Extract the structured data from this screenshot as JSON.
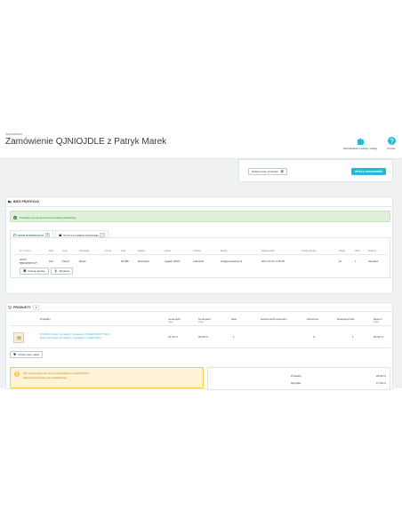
{
  "header": {
    "breadcrumb": "Zamówienia",
    "title": "Zamówienie QJNIOJDLE z Patryk Marek",
    "tools": [
      {
        "label": "Zarzadzanie modułyi i usługi",
        "icon": "puzzle-icon"
      },
      {
        "label": "Pomoc",
        "icon": "help-icon"
      }
    ]
  },
  "top_strip": {
    "tracking_label": "Podaj numer przesyłki",
    "submit_label": "WYŚLIJ WIADOMOŚĆ"
  },
  "returns": {
    "title": "BIEG PRZESYŁKI",
    "success_alert": "Przesyłka nie ma opóźnień od ostatniej aktualizacji",
    "tabs": [
      {
        "label": "STATUS PRZESYŁKI",
        "count": "0"
      },
      {
        "label": "WYSYŁKI (ZREALIZOWANE)",
        "count": "1"
      }
    ],
    "columns": [
      "Nr. Numer",
      "Płeć",
      "Imię",
      "Nazwisko",
      "Firma",
      "Kod",
      "Miasto",
      "Adres",
      "Telefon",
      "Email",
      "Data Krótko",
      "Uwagi dla kur.",
      "Waga",
      "Ilość",
      "Rodzaj"
    ],
    "row": [
      "32376",
      "Pan",
      "Patryk",
      "Marek",
      "",
      "00-585",
      "Dzierżków",
      "Jagiełły 06/15",
      "111111111",
      "info@prestashop.pl",
      "2017-07-01 17:59:56",
      "",
      "10",
      "1",
      "Standard"
    ],
    "row_sub": "5884483877377",
    "actions": [
      {
        "label": "Drukuj paczkę",
        "icon": "print-icon"
      },
      {
        "label": "Wydanie",
        "icon": "upload-icon"
      }
    ]
  },
  "products": {
    "title": "PRODUKTY",
    "count": "1",
    "columns": [
      {
        "label": "Produkty",
        "sub": ""
      },
      {
        "label": "Cena jedn.",
        "sub": "netto"
      },
      {
        "label": "Cena jedn.",
        "sub": "brutto"
      },
      {
        "label": "Ilość",
        "sub": ""
      },
      {
        "label": "Zwrócono/Z powrotem",
        "sub": ""
      },
      {
        "label": "Zwrócono",
        "sub": ""
      },
      {
        "label": "Dostępna ilość",
        "sub": ""
      },
      {
        "label": "Razem",
        "sub": "brutto"
      }
    ],
    "item": {
      "name_line1": "DYLMICO krem do twarzy z kwasami NAGIETKOWY 50ml",
      "name_line2": "Krem odżywczy do twarzy z wyciągiem szałwii 50ml",
      "net": "24,30 zł",
      "gross": "29,90 zł",
      "qty": "1",
      "returned": "0",
      "available": "1",
      "total": "29,90 zł"
    },
    "add_discount_label": "Dodaj nowy rabat",
    "warning_line1": "Dla tej grupy klientów, ceny są wyświetlane w walucie Brutto",
    "warning_line2": "Rabat koszt dostawy jako kwalifikowany",
    "summary": [
      {
        "label": "Produkty",
        "value": "29,90 zł"
      },
      {
        "label": "Wysyłka",
        "value": "17,00 zł"
      }
    ]
  },
  "colors": {
    "accent": "#25b9d7",
    "success": "#2e7d3f",
    "warning": "#fcc94f"
  }
}
